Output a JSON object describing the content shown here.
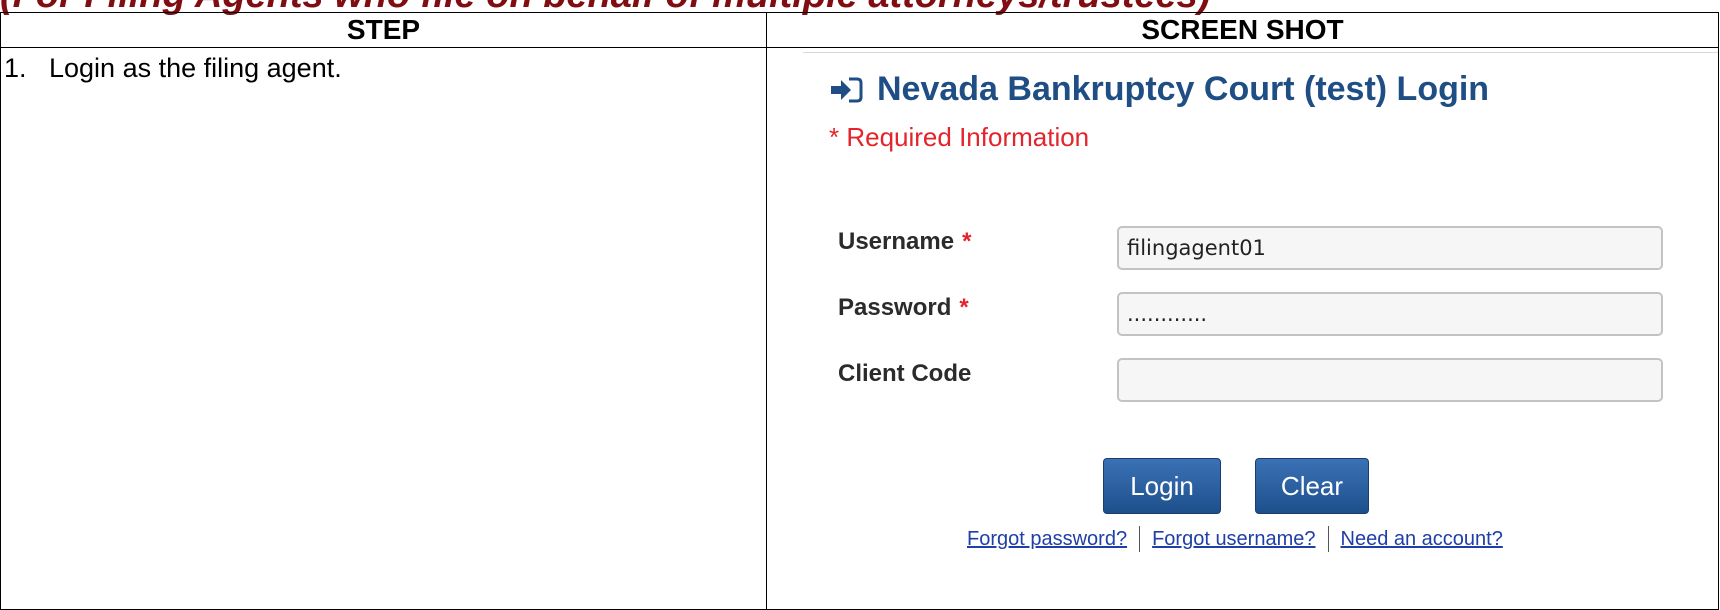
{
  "heading": "(For Filing Agents who file on behalf of multiple attorneys/trustees)",
  "table": {
    "header_step": "STEP",
    "header_screenshot": "SCREEN SHOT"
  },
  "step": {
    "number": "1.",
    "text": "Login as the filing agent."
  },
  "login": {
    "icon": "sign-in-arrow-icon",
    "title": "Nevada Bankruptcy Court (test) Login",
    "required_note": "* Required Information",
    "username_label": "Username",
    "username_value": "filingagent01",
    "password_label": "Password",
    "password_value": "............",
    "client_code_label": "Client Code",
    "client_code_value": "",
    "required_star": "*",
    "login_button": "Login",
    "clear_button": "Clear",
    "forgot_password": "Forgot password?",
    "forgot_username": "Forgot username?",
    "need_account": "Need an account?",
    "colors": {
      "title": "#1f4e85",
      "required": "#e3242b",
      "button": "#2a5fa0",
      "link": "#1f3ea8",
      "heading": "#7f0d12"
    }
  }
}
